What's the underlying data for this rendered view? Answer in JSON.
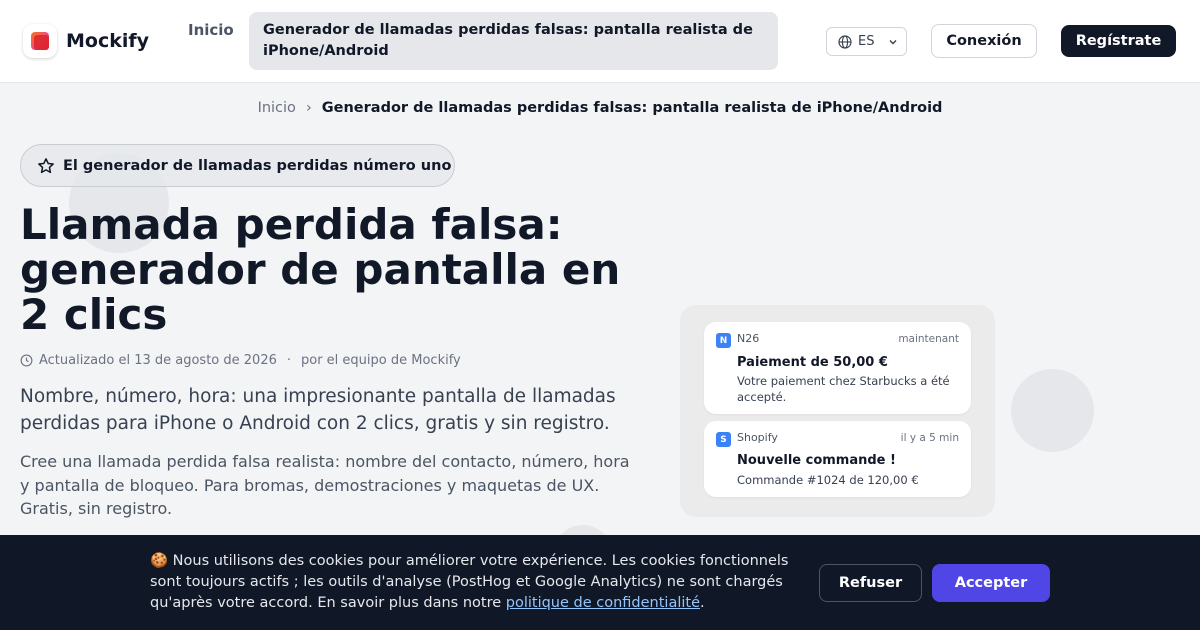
{
  "header": {
    "brand": "Mockify",
    "nav_home": "Inicio",
    "nav_current": "Generador de llamadas perdidas falsas: pantalla realista de iPhone/Android",
    "language": "ES",
    "login_label": "Conexión",
    "register_label": "Regístrate"
  },
  "breadcrumb": {
    "home": "Inicio",
    "separator": "›",
    "current": "Generador de llamadas perdidas falsas: pantalla realista de iPhone/Android"
  },
  "hero": {
    "badge": "El generador de llamadas perdidas número uno",
    "title": "Llamada perdida falsa: generador de pantalla en 2 clics",
    "updated": "Actualizado el 13 de agosto de 2026",
    "meta_separator": "·",
    "author": "por el equipo de Mockify",
    "lead": "Nombre, número, hora: una impresionante pantalla de llamadas perdidas para iPhone o Android con 2 clics, gratis y sin registro.",
    "description": "Cree una llamada perdida falsa realista: nombre del contacto, número, hora y pantalla de bloqueo. Para bromas, demostraciones y maquetas de UX. Gratis, sin registro."
  },
  "notifications": [
    {
      "icon_letter": "N",
      "app": "N26",
      "time": "maintenant",
      "title": "Paiement de 50,00 €",
      "body": "Votre paiement chez Starbucks a été accepté."
    },
    {
      "icon_letter": "S",
      "app": "Shopify",
      "time": "il y a 5 min",
      "title": "Nouvelle commande !",
      "body": "Commande #1024 de 120,00 €"
    }
  ],
  "cookie": {
    "emoji": "🍪",
    "text": "Nous utilisons des cookies pour améliorer votre expérience. Les cookies fonctionnels sont toujours actifs ; les outils d'analyse (PostHog et Google Analytics) ne sont chargés qu'après votre accord. En savoir plus dans notre",
    "link": "politique de confidentialité",
    "end": ".",
    "refuse_label": "Refuser",
    "accept_label": "Accepter"
  },
  "colors": {
    "primary_dark": "#111827",
    "accent": "#4f46e5",
    "banner_bg": "#101828",
    "app_icon": "#3b82f6"
  }
}
